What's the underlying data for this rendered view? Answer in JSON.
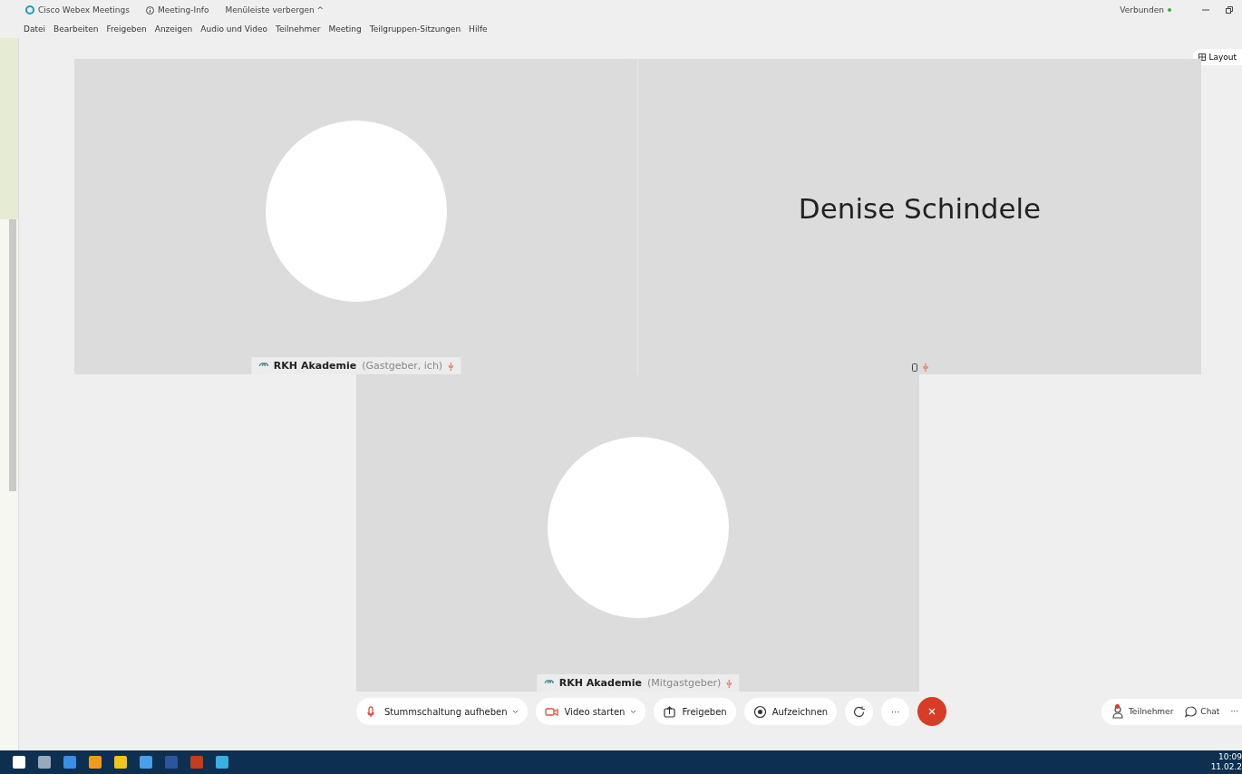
{
  "title_bar": {
    "app_name": "Cisco Webex Meetings",
    "meeting_info": "Meeting-Info",
    "hide_menu": "Menüleiste verbergen",
    "hide_caret": "^",
    "status": "Verbunden"
  },
  "menu": [
    "Datei",
    "Bearbeiten",
    "Freigeben",
    "Anzeigen",
    "Audio und Video",
    "Teilnehmer",
    "Meeting",
    "Teilgruppen-Sitzungen",
    "Hilfe"
  ],
  "layout_button": "Layout",
  "tiles": [
    {
      "kind": "avatar",
      "name": "RKH Akademie",
      "role": "(Gastgeber, ich)",
      "muted": true
    },
    {
      "kind": "name",
      "display_name": "Denise Schindele",
      "muted": true
    },
    {
      "kind": "avatar",
      "name": "RKH Akademie",
      "role": "(Mitgastgeber)",
      "muted": true
    }
  ],
  "controls": [
    {
      "kind": "pill",
      "label": "Stummschaltung aufheben",
      "dropdown": true
    },
    {
      "kind": "pill",
      "label": "Video starten",
      "dropdown": true
    },
    {
      "kind": "pill",
      "label": "Freigeben",
      "dropdown": false
    },
    {
      "kind": "pill",
      "label": "Aufzeichnen",
      "dropdown": false
    },
    {
      "kind": "icon"
    },
    {
      "kind": "round",
      "label": "···"
    },
    {
      "kind": "end"
    }
  ],
  "side_controls": [
    {
      "label": "Teilnehmer",
      "alert": true
    },
    {
      "label": "Chat",
      "alert": false
    },
    {
      "label": "···",
      "alert": false
    }
  ],
  "clock": {
    "time": "10:09",
    "date": "11.02.2"
  }
}
